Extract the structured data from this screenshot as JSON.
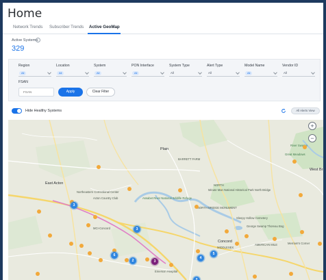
{
  "page": {
    "title": "Home"
  },
  "tabs": [
    {
      "label": "Network Trends",
      "active": false
    },
    {
      "label": "Subscriber Trends",
      "active": false
    },
    {
      "label": "Active GeoMap",
      "active": true
    }
  ],
  "summary": {
    "label": "Active Systems",
    "info_icon": "i",
    "count": "329"
  },
  "filters": [
    {
      "label": "Region",
      "value": "All",
      "chip": true
    },
    {
      "label": "Location",
      "value": "All",
      "chip": true
    },
    {
      "label": "System",
      "value": "All",
      "chip": true
    },
    {
      "label": "PON Interface",
      "value": "All",
      "chip": true
    },
    {
      "label": "System Type",
      "value": "All",
      "chip": false
    },
    {
      "label": "Alert Type",
      "value": "All",
      "chip": false
    },
    {
      "label": "Model Name",
      "value": "All",
      "chip": true
    },
    {
      "label": "Vendor ID",
      "value": "All",
      "chip": false
    }
  ],
  "fsan": {
    "label": "FSAN",
    "placeholder": "FSAN"
  },
  "buttons": {
    "apply": "Apply",
    "clear": "Clear Filter",
    "all_alerts": "All Alerts View"
  },
  "toggle": {
    "label": "Hide Healthy Systems",
    "on": true
  },
  "map": {
    "zoom_in": "+",
    "zoom_out": "−",
    "places": [
      "Plain",
      "BARRETT FARM",
      "East Acton",
      "Northeastern Correctional Center",
      "Acton Country Club",
      "NORTH",
      "Assabet River National Wildlife Refuge",
      "Minute Man National Historical Park North Bridge",
      "NORTH BRIDGE MONUMENT",
      "Sleepy Hollow Cemetery",
      "George Swamp Thoreau Bog",
      "Concord",
      "MIDDLESEX",
      "MCI-Concord",
      "AMERICAN MILE",
      "Emerson Hospital",
      "River Swamp",
      "Great Meadows",
      "Merriam's Corner",
      "West Br"
    ],
    "cluster_counts": [
      "3",
      "3",
      "6",
      "2",
      "3",
      "5",
      "4",
      "2"
    ],
    "colors": {
      "healthy": "#f2a93b",
      "cluster": "#2f86e0",
      "critical": "#7a1f7a"
    }
  }
}
